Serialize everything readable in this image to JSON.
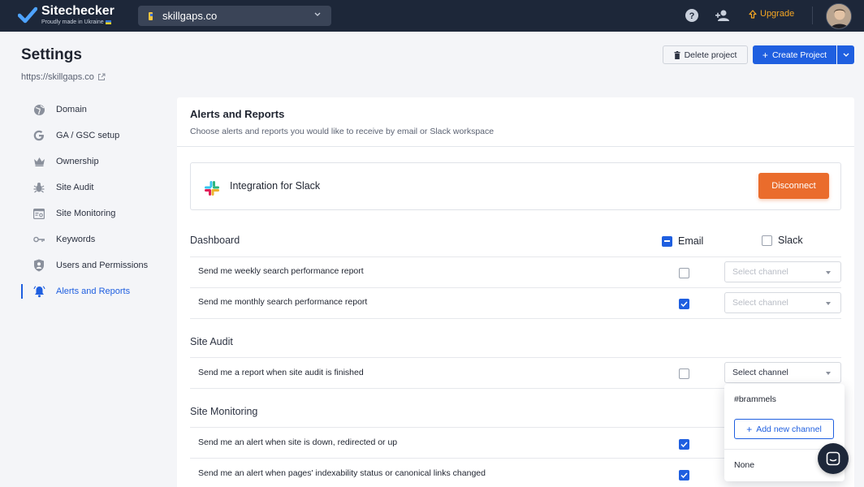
{
  "topbar": {
    "brand": "Sitechecker",
    "tagline": "Proudly made in Ukraine",
    "project": "skillgaps.co",
    "upgrade_label": "Upgrade"
  },
  "header": {
    "title": "Settings",
    "url": "https://skillgaps.co",
    "delete_label": "Delete project",
    "create_label": "Create Project"
  },
  "sidebar": {
    "items": [
      {
        "label": "Domain",
        "icon": "globe-icon"
      },
      {
        "label": "GA / GSC setup",
        "icon": "google-icon"
      },
      {
        "label": "Ownership",
        "icon": "crown-icon"
      },
      {
        "label": "Site Audit",
        "icon": "bug-icon"
      },
      {
        "label": "Site Monitoring",
        "icon": "monitor-icon"
      },
      {
        "label": "Keywords",
        "icon": "key-icon"
      },
      {
        "label": "Users and Permissions",
        "icon": "shield-user-icon"
      },
      {
        "label": "Alerts and Reports",
        "icon": "bell-icon",
        "active": true
      }
    ]
  },
  "main": {
    "title": "Alerts and Reports",
    "subtitle": "Choose alerts and reports you would like to receive by email or Slack workspace",
    "slack": {
      "title": "Integration for Slack",
      "disconnect_label": "Disconnect"
    },
    "columns": {
      "email": "Email",
      "slack": "Slack"
    },
    "sections": [
      {
        "title": "Dashboard",
        "rows": [
          {
            "label": "Send me weekly search performance report",
            "email": false,
            "channel": "Select channel"
          },
          {
            "label": "Send me monthly search performance report",
            "email": true,
            "channel": "Select channel"
          }
        ]
      },
      {
        "title": "Site Audit",
        "rows": [
          {
            "label": "Send me a report when site audit is finished",
            "email": false,
            "channel": "Select channel"
          }
        ]
      },
      {
        "title": "Site Monitoring",
        "rows": [
          {
            "label": "Send me an alert when site is down, redirected or up",
            "email": true
          },
          {
            "label": "Send me an alert when pages' indexability status or canonical links changed",
            "email": true
          }
        ]
      }
    ],
    "dropdown": {
      "options": [
        "#brammels",
        "None"
      ],
      "add_label": "Add new channel"
    }
  },
  "colors": {
    "accent": "#1f5fe0",
    "topbar": "#1d2739",
    "disconnect": "#ea6c2c",
    "upgrade": "#f5a623"
  }
}
